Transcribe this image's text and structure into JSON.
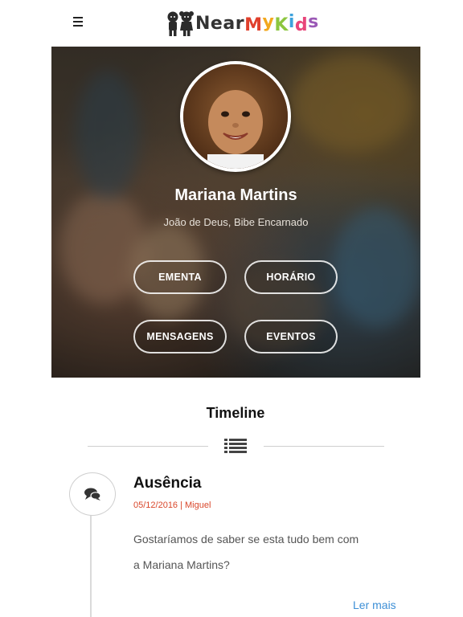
{
  "header": {
    "menu_icon": "hamburger-menu-icon",
    "logo_text": [
      "N",
      "e",
      "a",
      "r",
      "M",
      "y",
      "K",
      "i",
      "d",
      "s"
    ],
    "logo_colors": [
      "#333333",
      "#333333",
      "#333333",
      "#333333",
      "#e0402c",
      "#f2a81d",
      "#8cc63f",
      "#3da2dc",
      "#e8457a",
      "#9b59b6"
    ]
  },
  "profile": {
    "name": "Mariana Martins",
    "school": "João de Deus, Bibe Encarnado",
    "buttons": {
      "ementa": "EMENTA",
      "horario": "HORÁRIO",
      "mensagens": "MENSAGENS",
      "eventos": "EVENTOS"
    }
  },
  "timeline": {
    "title": "Timeline",
    "icon": "list-icon",
    "item": {
      "icon": "chat-bubble-icon",
      "title": "Ausência",
      "meta": "05/12/2016 | Miguel",
      "body_line1": "Gostaríamos de saber se esta tudo bem com",
      "body_line2": "a Mariana Martins?",
      "read_more": "Ler mais"
    }
  },
  "colors": {
    "accent_link": "#3d8fd6",
    "meta_red": "#d9472b"
  }
}
